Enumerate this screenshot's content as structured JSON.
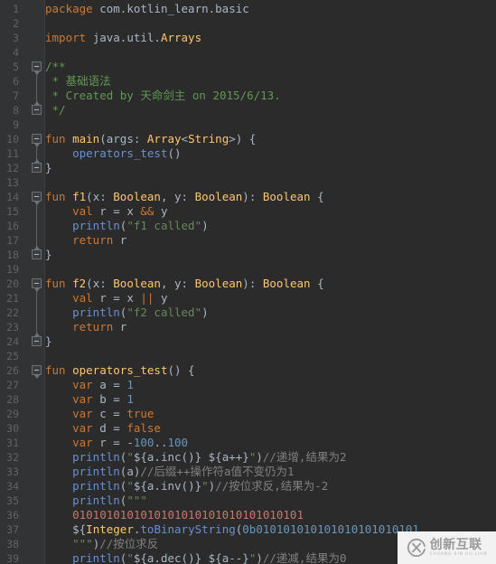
{
  "editor": {
    "language": "Kotlin",
    "theme": "Darcula",
    "background_color": "#2b2b2b",
    "gutter_color": "#313335",
    "line_number_color": "#606366",
    "default_text_color": "#a9b7c6",
    "keyword_color": "#cc7832",
    "function_color": "#ffc66d",
    "string_color": "#6a8759",
    "number_color": "#6897bb",
    "comment_color": "#808080",
    "doc_comment_color": "#629755",
    "call_color": "#6a8fd4",
    "first_line": 1,
    "last_line": 39,
    "line_height": 16
  },
  "lines": [
    {
      "n": 1,
      "fold": null,
      "tokens": [
        {
          "t": "package ",
          "c": "kw"
        },
        {
          "t": "com.kotlin_learn.basic",
          "c": "id"
        }
      ]
    },
    {
      "n": 2,
      "fold": null,
      "tokens": []
    },
    {
      "n": 3,
      "fold": null,
      "tokens": [
        {
          "t": "import ",
          "c": "kw"
        },
        {
          "t": "java.util.",
          "c": "id"
        },
        {
          "t": "Arrays",
          "c": "fn"
        }
      ]
    },
    {
      "n": 4,
      "fold": null,
      "tokens": []
    },
    {
      "n": 5,
      "fold": "open",
      "tokens": [
        {
          "t": "/**",
          "c": "doc"
        }
      ]
    },
    {
      "n": 6,
      "fold": null,
      "tokens": [
        {
          "t": " * 基础语法",
          "c": "doc"
        }
      ]
    },
    {
      "n": 7,
      "fold": null,
      "tokens": [
        {
          "t": " * Created by 天命剑主 on 2015/6/13.",
          "c": "doc"
        }
      ]
    },
    {
      "n": 8,
      "fold": "close",
      "tokens": [
        {
          "t": " */",
          "c": "doc"
        }
      ]
    },
    {
      "n": 9,
      "fold": null,
      "tokens": []
    },
    {
      "n": 10,
      "fold": "open",
      "tokens": [
        {
          "t": "fun ",
          "c": "kw"
        },
        {
          "t": "main",
          "c": "fn"
        },
        {
          "t": "(args: ",
          "c": "id"
        },
        {
          "t": "Array",
          "c": "fn"
        },
        {
          "t": "<",
          "c": "id"
        },
        {
          "t": "String",
          "c": "fn"
        },
        {
          "t": ">) {",
          "c": "id"
        }
      ]
    },
    {
      "n": 11,
      "fold": null,
      "tokens": [
        {
          "t": "    ",
          "c": "id"
        },
        {
          "t": "operators_test",
          "c": "call"
        },
        {
          "t": "()",
          "c": "id"
        }
      ]
    },
    {
      "n": 12,
      "fold": "close",
      "tokens": [
        {
          "t": "}",
          "c": "id"
        }
      ]
    },
    {
      "n": 13,
      "fold": null,
      "tokens": []
    },
    {
      "n": 14,
      "fold": "open",
      "tokens": [
        {
          "t": "fun ",
          "c": "kw"
        },
        {
          "t": "f1",
          "c": "fn"
        },
        {
          "t": "(x: ",
          "c": "id"
        },
        {
          "t": "Boolean",
          "c": "fn"
        },
        {
          "t": ", y: ",
          "c": "id"
        },
        {
          "t": "Boolean",
          "c": "fn"
        },
        {
          "t": "): ",
          "c": "id"
        },
        {
          "t": "Boolean",
          "c": "fn"
        },
        {
          "t": " {",
          "c": "id"
        }
      ]
    },
    {
      "n": 15,
      "fold": null,
      "tokens": [
        {
          "t": "    ",
          "c": "id"
        },
        {
          "t": "val ",
          "c": "kw"
        },
        {
          "t": "r = x ",
          "c": "id"
        },
        {
          "t": "&&",
          "c": "kw"
        },
        {
          "t": " y",
          "c": "id"
        }
      ]
    },
    {
      "n": 16,
      "fold": null,
      "tokens": [
        {
          "t": "    ",
          "c": "id"
        },
        {
          "t": "println",
          "c": "call"
        },
        {
          "t": "(",
          "c": "id"
        },
        {
          "t": "\"f1 called\"",
          "c": "str"
        },
        {
          "t": ")",
          "c": "id"
        }
      ]
    },
    {
      "n": 17,
      "fold": null,
      "tokens": [
        {
          "t": "    ",
          "c": "id"
        },
        {
          "t": "return ",
          "c": "kw"
        },
        {
          "t": "r",
          "c": "id"
        }
      ]
    },
    {
      "n": 18,
      "fold": "close",
      "tokens": [
        {
          "t": "}",
          "c": "id"
        }
      ]
    },
    {
      "n": 19,
      "fold": null,
      "tokens": []
    },
    {
      "n": 20,
      "fold": "open",
      "tokens": [
        {
          "t": "fun ",
          "c": "kw"
        },
        {
          "t": "f2",
          "c": "fn"
        },
        {
          "t": "(x: ",
          "c": "id"
        },
        {
          "t": "Boolean",
          "c": "fn"
        },
        {
          "t": ", y: ",
          "c": "id"
        },
        {
          "t": "Boolean",
          "c": "fn"
        },
        {
          "t": "): ",
          "c": "id"
        },
        {
          "t": "Boolean",
          "c": "fn"
        },
        {
          "t": " {",
          "c": "id"
        }
      ]
    },
    {
      "n": 21,
      "fold": null,
      "tokens": [
        {
          "t": "    ",
          "c": "id"
        },
        {
          "t": "val ",
          "c": "kw"
        },
        {
          "t": "r = x ",
          "c": "id"
        },
        {
          "t": "||",
          "c": "kw"
        },
        {
          "t": " y",
          "c": "id"
        }
      ]
    },
    {
      "n": 22,
      "fold": null,
      "tokens": [
        {
          "t": "    ",
          "c": "id"
        },
        {
          "t": "println",
          "c": "call"
        },
        {
          "t": "(",
          "c": "id"
        },
        {
          "t": "\"f2 called\"",
          "c": "str"
        },
        {
          "t": ")",
          "c": "id"
        }
      ]
    },
    {
      "n": 23,
      "fold": null,
      "tokens": [
        {
          "t": "    ",
          "c": "id"
        },
        {
          "t": "return ",
          "c": "kw"
        },
        {
          "t": "r",
          "c": "id"
        }
      ]
    },
    {
      "n": 24,
      "fold": "close",
      "tokens": [
        {
          "t": "}",
          "c": "id"
        }
      ]
    },
    {
      "n": 25,
      "fold": null,
      "tokens": []
    },
    {
      "n": 26,
      "fold": "open",
      "tokens": [
        {
          "t": "fun ",
          "c": "kw"
        },
        {
          "t": "operators_test",
          "c": "fn"
        },
        {
          "t": "() {",
          "c": "id"
        }
      ]
    },
    {
      "n": 27,
      "fold": null,
      "tokens": [
        {
          "t": "    ",
          "c": "id"
        },
        {
          "t": "var ",
          "c": "kw"
        },
        {
          "t": "a = ",
          "c": "id"
        },
        {
          "t": "1",
          "c": "num"
        }
      ]
    },
    {
      "n": 28,
      "fold": null,
      "tokens": [
        {
          "t": "    ",
          "c": "id"
        },
        {
          "t": "var ",
          "c": "kw"
        },
        {
          "t": "b = ",
          "c": "id"
        },
        {
          "t": "1",
          "c": "num"
        }
      ]
    },
    {
      "n": 29,
      "fold": null,
      "tokens": [
        {
          "t": "    ",
          "c": "id"
        },
        {
          "t": "var ",
          "c": "kw"
        },
        {
          "t": "c = ",
          "c": "id"
        },
        {
          "t": "true",
          "c": "kw"
        }
      ]
    },
    {
      "n": 30,
      "fold": null,
      "tokens": [
        {
          "t": "    ",
          "c": "id"
        },
        {
          "t": "var ",
          "c": "kw"
        },
        {
          "t": "d = ",
          "c": "id"
        },
        {
          "t": "false",
          "c": "kw"
        }
      ]
    },
    {
      "n": 31,
      "fold": null,
      "tokens": [
        {
          "t": "    ",
          "c": "id"
        },
        {
          "t": "var ",
          "c": "kw"
        },
        {
          "t": "r = -",
          "c": "id"
        },
        {
          "t": "100",
          "c": "num"
        },
        {
          "t": "..",
          "c": "id"
        },
        {
          "t": "100",
          "c": "num"
        }
      ]
    },
    {
      "n": 32,
      "fold": null,
      "tokens": [
        {
          "t": "    ",
          "c": "id"
        },
        {
          "t": "println",
          "c": "call"
        },
        {
          "t": "(",
          "c": "id"
        },
        {
          "t": "\"",
          "c": "str"
        },
        {
          "t": "${a.inc()}",
          "c": "tmplb"
        },
        {
          "t": " ",
          "c": "str"
        },
        {
          "t": "${a++}",
          "c": "tmplb"
        },
        {
          "t": "\"",
          "c": "str"
        },
        {
          "t": ")",
          "c": "id"
        },
        {
          "t": "//递增,结果为2",
          "c": "cmt"
        }
      ]
    },
    {
      "n": 33,
      "fold": null,
      "tokens": [
        {
          "t": "    ",
          "c": "id"
        },
        {
          "t": "println",
          "c": "call"
        },
        {
          "t": "(a)",
          "c": "id"
        },
        {
          "t": "//后缀++操作符a值不变仍为1",
          "c": "cmt"
        }
      ]
    },
    {
      "n": 34,
      "fold": null,
      "tokens": [
        {
          "t": "    ",
          "c": "id"
        },
        {
          "t": "println",
          "c": "call"
        },
        {
          "t": "(",
          "c": "id"
        },
        {
          "t": "\"",
          "c": "str"
        },
        {
          "t": "${a.inv()}",
          "c": "tmplb"
        },
        {
          "t": "\"",
          "c": "str"
        },
        {
          "t": ")",
          "c": "id"
        },
        {
          "t": "//按位求反,结果为-2",
          "c": "cmt"
        }
      ]
    },
    {
      "n": 35,
      "fold": null,
      "tokens": [
        {
          "t": "    ",
          "c": "id"
        },
        {
          "t": "println",
          "c": "call"
        },
        {
          "t": "(",
          "c": "id"
        },
        {
          "t": "\"\"\"",
          "c": "str"
        }
      ]
    },
    {
      "n": 36,
      "fold": null,
      "tokens": [
        {
          "t": "    ",
          "c": "id"
        },
        {
          "t": "0101010101010101010101010101010101",
          "c": "binstr"
        }
      ]
    },
    {
      "n": 37,
      "fold": null,
      "tokens": [
        {
          "t": "    ",
          "c": "id"
        },
        {
          "t": "${",
          "c": "tmplb"
        },
        {
          "t": "Integer",
          "c": "fn"
        },
        {
          "t": ".",
          "c": "id"
        },
        {
          "t": "toBinaryString",
          "c": "call"
        },
        {
          "t": "(",
          "c": "id"
        },
        {
          "t": "0b010101010101010101010101",
          "c": "num"
        }
      ]
    },
    {
      "n": 38,
      "fold": null,
      "tokens": [
        {
          "t": "    ",
          "c": "id"
        },
        {
          "t": "\"\"\"",
          "c": "str"
        },
        {
          "t": ")",
          "c": "id"
        },
        {
          "t": "//按位求反",
          "c": "cmt"
        }
      ]
    },
    {
      "n": 39,
      "fold": null,
      "tokens": [
        {
          "t": "    ",
          "c": "id"
        },
        {
          "t": "println",
          "c": "call"
        },
        {
          "t": "(",
          "c": "id"
        },
        {
          "t": "\"",
          "c": "str"
        },
        {
          "t": "${a.dec()}",
          "c": "tmplb"
        },
        {
          "t": " ",
          "c": "str"
        },
        {
          "t": "${a--}",
          "c": "tmplb"
        },
        {
          "t": "\"",
          "c": "str"
        },
        {
          "t": ")",
          "c": "id"
        },
        {
          "t": "//递减,结果为0",
          "c": "cmt"
        }
      ]
    }
  ],
  "watermark": {
    "chinese": "创新互联",
    "pinyin": "CHUANG XIN HU LIAN",
    "logo_letter": "X",
    "background": "#f2f2f2",
    "text_color": "#9a9a9a"
  }
}
